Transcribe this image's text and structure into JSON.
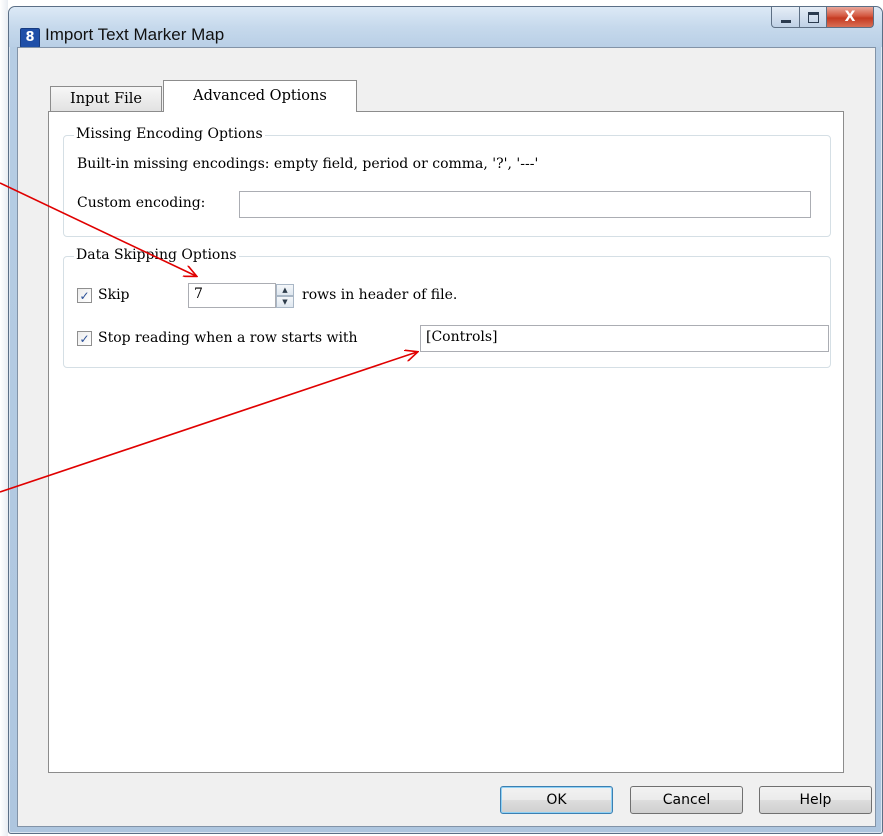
{
  "window": {
    "title": "Import Text Marker Map",
    "app_icon_glyph": "8",
    "close_glyph": "X"
  },
  "tabs": [
    {
      "label": "Input File",
      "active": false
    },
    {
      "label": "Advanced Options",
      "active": true
    }
  ],
  "missing_encoding": {
    "legend": "Missing Encoding Options",
    "builtin_text": "Built-in missing encodings: empty field, period or comma, '?', '---'",
    "custom_label": "Custom  encoding:",
    "custom_value": ""
  },
  "data_skipping": {
    "legend": "Data Skipping Options",
    "skip_checked": true,
    "skip_label": "Skip",
    "skip_value": "7",
    "skip_suffix": "rows in header of file.",
    "stop_checked": true,
    "stop_label": "Stop reading when a row starts with",
    "stop_value": "[Controls]"
  },
  "buttons": {
    "ok": "OK",
    "cancel": "Cancel",
    "help": "Help"
  },
  "colors": {
    "annotation_arrow": "#e00000",
    "close_button": "#c43a21",
    "checkmark": "#2a4f96"
  },
  "icons": {
    "app": "app-logo-icon",
    "minimize": "minimize-icon",
    "maximize": "maximize-icon",
    "close": "close-icon",
    "spin_up": "chevron-up-icon",
    "spin_down": "chevron-down-icon",
    "checkmark": "checkmark-icon"
  }
}
